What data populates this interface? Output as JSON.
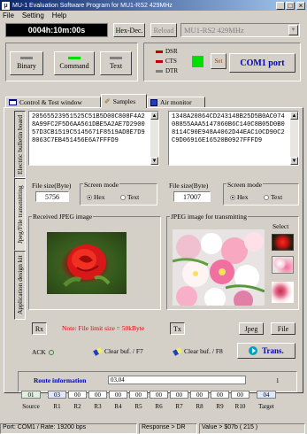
{
  "window": {
    "title": "MU-1 Evaluation Software Program for MU1-RS2   429MHz"
  },
  "menu": [
    "File",
    "Setting",
    "Help"
  ],
  "toolbar": {
    "timer": "0004h:10m:00s",
    "hex_dec_label": "Hex-Dec.",
    "reload_label": "Reload",
    "device_select": "MU1-RS2  429MHz"
  },
  "modes": {
    "binary": "Binary",
    "command": "Command",
    "text": "Text"
  },
  "signals": {
    "dsr": "DSR",
    "cts": "CTS",
    "dtr": "DTR"
  },
  "port": {
    "set_label": "Set",
    "com_label": "COM1 port"
  },
  "tabs": [
    "Control & Test window",
    "Samples",
    "Air monitor"
  ],
  "side_tabs": [
    "Electric bulletin board",
    "Jpeg/File transmitting",
    "Application design kit"
  ],
  "received": {
    "hex_data": "20565523951525C51B5D00C808F4A28A99FC2F5D6AA561DBE5A2AE7D290057D3CB1519C5145671F8519AD8E7D98063C7EB451456E6A7FFFD9",
    "file_size_label": "File size(Byte)",
    "file_size": "5756",
    "screen_mode_label": "Screen mode",
    "hex_label": "Hex",
    "text_label": "Text",
    "image_label": "Received JPEG image",
    "rx_label": "Rx",
    "note": "Note: File limit size = 50kByte",
    "ack_label": "ACK",
    "clear_label": "Clear buf. / F7"
  },
  "transmit": {
    "hex_data": "1348A20864CD243148B25D5B0AC07408855AAA5147860B6C140C8B05D0B08114C90E948A4062D44EAC10CD90C2C9D06916E16520B0927FFFD9",
    "file_size_label": "File size(Byte)",
    "file_size": "17007",
    "screen_mode_label": "Screen mode",
    "hex_label": "Hex",
    "text_label": "Text",
    "image_label": "JPEG image for transmitting",
    "select_label": "Select",
    "tx_label": "Tx",
    "jpeg_label": "Jpeg",
    "file_label": "File",
    "clear_label": "Clear buf. / F8",
    "trans_label": "Trans."
  },
  "route": {
    "title": "Route information",
    "route_value": "03,04",
    "count": "1",
    "source_value": "01",
    "relays": [
      "03",
      "00",
      "00",
      "00",
      "00",
      "00",
      "00",
      "00",
      "00",
      "00"
    ],
    "target_value": "04",
    "source_label": "Source",
    "relay_labels": [
      "R1",
      "R2",
      "R3",
      "R4",
      "R5",
      "R6",
      "R7",
      "R8",
      "R9",
      "R10"
    ],
    "target_label": "Target"
  },
  "status": {
    "port": "Port: COM1 / Rate: 19200 bps",
    "response": "Response > DR",
    "value": "Value > $07b ( 215 )"
  },
  "colors": {
    "route_blue": "#0000c0",
    "note_red": "#e00000",
    "led_green": "#00e000",
    "led_red": "#c00000"
  }
}
